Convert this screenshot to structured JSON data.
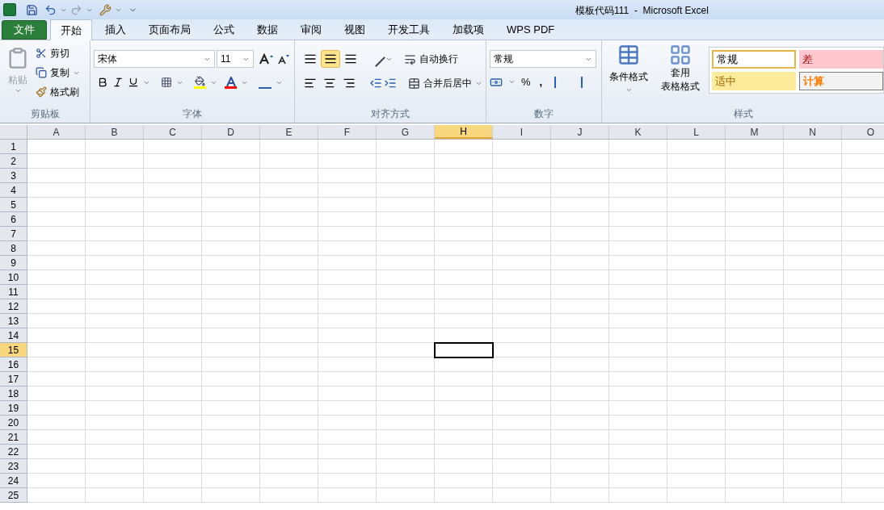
{
  "window": {
    "title": "模板代码111  -  Microsoft Excel"
  },
  "tabs": [
    {
      "label": "文件",
      "kind": "file",
      "selected": false
    },
    {
      "label": "开始",
      "kind": "tab",
      "selected": true
    },
    {
      "label": "插入",
      "kind": "tab",
      "selected": false
    },
    {
      "label": "页面布局",
      "kind": "tab",
      "selected": false
    },
    {
      "label": "公式",
      "kind": "tab",
      "selected": false
    },
    {
      "label": "数据",
      "kind": "tab",
      "selected": false
    },
    {
      "label": "审阅",
      "kind": "tab",
      "selected": false
    },
    {
      "label": "视图",
      "kind": "tab",
      "selected": false
    },
    {
      "label": "开发工具",
      "kind": "tab",
      "selected": false
    },
    {
      "label": "加载项",
      "kind": "tab",
      "selected": false
    },
    {
      "label": "WPS PDF",
      "kind": "tab",
      "selected": false
    }
  ],
  "clipboard": {
    "label": "剪贴板",
    "paste": {
      "label": "粘贴",
      "disabled": true
    },
    "cut": "剪切",
    "copy": "复制",
    "format_painter": "格式刷"
  },
  "font": {
    "label": "字体",
    "font_name": "宋体",
    "font_size": "11"
  },
  "alignment": {
    "label": "对齐方式",
    "middle_align_selected": true,
    "wrap_text": "自动换行",
    "merge_center": "合并后居中"
  },
  "number": {
    "label": "数字",
    "format": "常规",
    "percent": "%",
    "comma": ","
  },
  "styles": {
    "label": "样式",
    "conditional_format": "条件格式",
    "table_format": [
      "套用",
      "表格格式"
    ],
    "cells": [
      {
        "label": "常规",
        "kind": "normal"
      },
      {
        "label": "差",
        "kind": "bad"
      },
      {
        "label": "适中",
        "kind": "neutral"
      },
      {
        "label": "计算",
        "kind": "calculation"
      }
    ]
  },
  "grid": {
    "columns": [
      {
        "label": "A",
        "selected": false
      },
      {
        "label": "B",
        "selected": false
      },
      {
        "label": "C",
        "selected": false
      },
      {
        "label": "D",
        "selected": false
      },
      {
        "label": "E",
        "selected": false
      },
      {
        "label": "F",
        "selected": false
      },
      {
        "label": "G",
        "selected": false
      },
      {
        "label": "H",
        "selected": true
      },
      {
        "label": "I",
        "selected": false
      },
      {
        "label": "J",
        "selected": false
      },
      {
        "label": "K",
        "selected": false
      },
      {
        "label": "L",
        "selected": false
      },
      {
        "label": "M",
        "selected": false
      },
      {
        "label": "N",
        "selected": false
      },
      {
        "label": "O",
        "selected": false
      }
    ],
    "rows": [
      {
        "label": "1",
        "selected": false
      },
      {
        "label": "2",
        "selected": false
      },
      {
        "label": "3",
        "selected": false
      },
      {
        "label": "4",
        "selected": false
      },
      {
        "label": "5",
        "selected": false
      },
      {
        "label": "6",
        "selected": false
      },
      {
        "label": "7",
        "selected": false
      },
      {
        "label": "8",
        "selected": false
      },
      {
        "label": "9",
        "selected": false
      },
      {
        "label": "10",
        "selected": false
      },
      {
        "label": "11",
        "selected": false
      },
      {
        "label": "12",
        "selected": false
      },
      {
        "label": "13",
        "selected": false
      },
      {
        "label": "14",
        "selected": false
      },
      {
        "label": "15",
        "selected": true
      },
      {
        "label": "16",
        "selected": false
      },
      {
        "label": "17",
        "selected": false
      },
      {
        "label": "18",
        "selected": false
      },
      {
        "label": "19",
        "selected": false
      },
      {
        "label": "20",
        "selected": false
      },
      {
        "label": "21",
        "selected": false
      },
      {
        "label": "22",
        "selected": false
      },
      {
        "label": "23",
        "selected": false
      },
      {
        "label": "24",
        "selected": false
      },
      {
        "label": "25",
        "selected": false
      }
    ]
  }
}
